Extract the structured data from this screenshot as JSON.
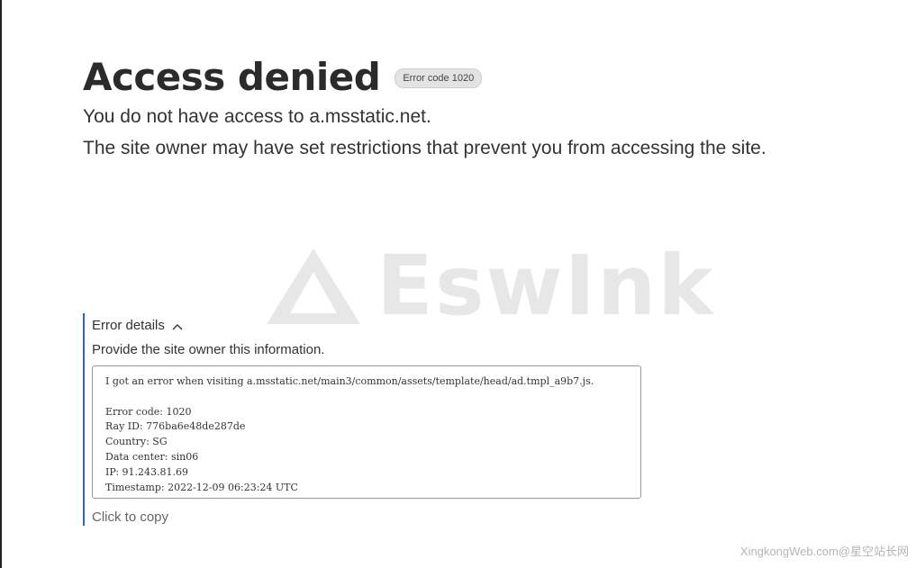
{
  "heading": {
    "title": "Access denied",
    "badge": "Error code 1020"
  },
  "messages": {
    "line1": "You do not have access to a.msstatic.net.",
    "line2": "The site owner may have set restrictions that prevent you from accessing the site."
  },
  "logo_watermark": {
    "text": "EswInk",
    "icon": "triangle-logo-icon"
  },
  "details": {
    "toggle_label": "Error details",
    "toggle_icon": "chevron-up-icon",
    "hint": "Provide the site owner this information.",
    "lines": [
      "I got an error when visiting a.msstatic.net/main3/common/assets/template/head/ad.tmpl_a9b7.js.",
      "",
      "Error code: 1020",
      "Ray ID: 776ba6e48de287de",
      "Country: SG",
      "Data center: sin06",
      "IP: 91.243.81.69",
      "Timestamp: 2022-12-09 06:23:24 UTC"
    ],
    "copy_label": "Click to copy"
  },
  "footer_watermark": "XingkongWeb.com@星空站长网",
  "colors": {
    "accent": "#2f66b3",
    "text": "#333333"
  }
}
